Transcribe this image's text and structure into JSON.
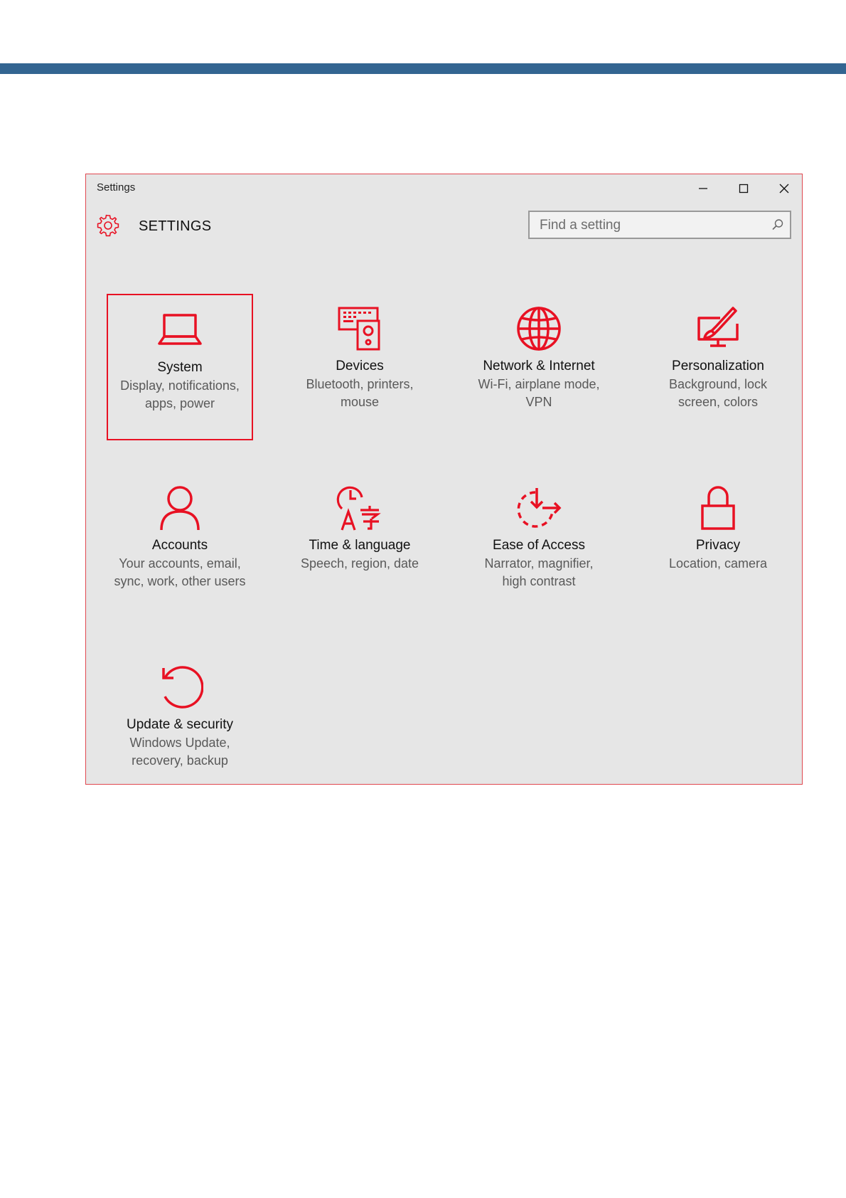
{
  "window": {
    "title": "Settings",
    "heading": "SETTINGS",
    "controls": {
      "minimize": "minimize-icon",
      "maximize": "maximize-icon",
      "close": "close-icon"
    }
  },
  "search": {
    "placeholder": "Find a setting",
    "value": "",
    "icon": "search-icon"
  },
  "colors": {
    "accent": "#e81123",
    "top_bar": "#336591",
    "window_bg": "#e6e6e6",
    "window_border": "#e0474f"
  },
  "tiles": [
    {
      "title": "System",
      "desc_line1": "Display, notifications,",
      "desc_line2": "apps, power",
      "icon": "laptop-icon",
      "selected": true
    },
    {
      "title": "Devices",
      "desc_line1": "Bluetooth, printers,",
      "desc_line2": "mouse",
      "icon": "devices-icon"
    },
    {
      "title": "Network & Internet",
      "desc_line1": "Wi-Fi, airplane mode,",
      "desc_line2": "VPN",
      "icon": "globe-icon"
    },
    {
      "title": "Personalization",
      "desc_line1": "Background, lock",
      "desc_line2": "screen, colors",
      "icon": "paintbrush-icon"
    },
    {
      "title": "Accounts",
      "desc_line1": "Your accounts, email,",
      "desc_line2": "sync, work, other users",
      "icon": "person-icon"
    },
    {
      "title": "Time & language",
      "desc_line1": "Speech, region, date",
      "desc_line2": "",
      "icon": "time-language-icon"
    },
    {
      "title": "Ease of Access",
      "desc_line1": "Narrator, magnifier,",
      "desc_line2": "high contrast",
      "icon": "ease-of-access-icon"
    },
    {
      "title": "Privacy",
      "desc_line1": "Location, camera",
      "desc_line2": "",
      "icon": "lock-icon"
    },
    {
      "title": "Update & security",
      "desc_line1": "Windows Update,",
      "desc_line2": "recovery, backup",
      "icon": "refresh-icon"
    }
  ]
}
